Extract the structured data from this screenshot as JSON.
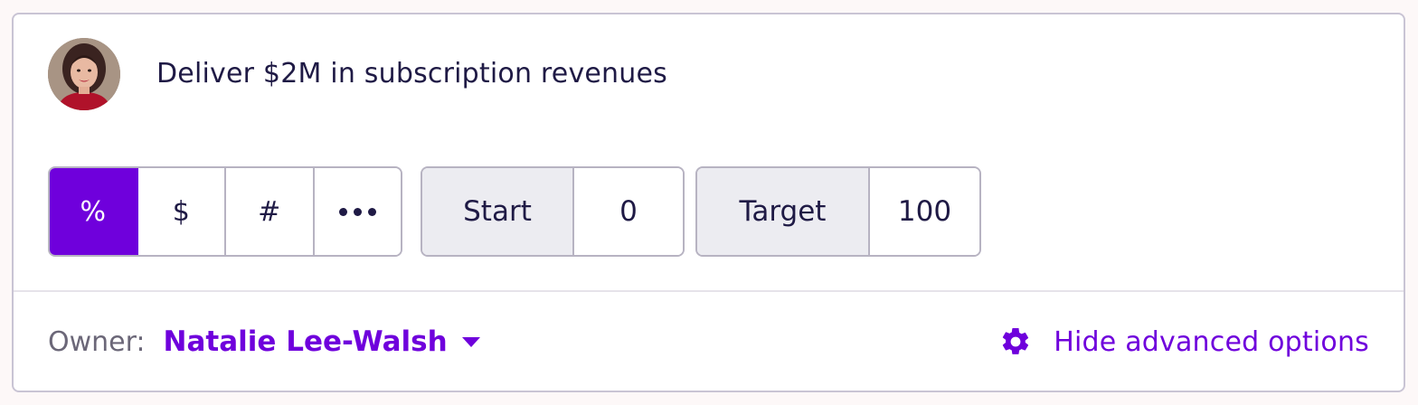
{
  "goal": {
    "title": "Deliver $2M in subscription revenues",
    "avatar_icon": "user-avatar-photo"
  },
  "unit_types": [
    {
      "label": "%",
      "active": true
    },
    {
      "label": "$",
      "active": false
    },
    {
      "label": "#",
      "active": false
    },
    {
      "label": "more",
      "icon": "ellipsis-icon",
      "active": false
    }
  ],
  "start": {
    "label": "Start",
    "value": "0"
  },
  "target": {
    "label": "Target",
    "value": "100"
  },
  "owner": {
    "label": "Owner:",
    "name": "Natalie Lee-Walsh"
  },
  "advanced": {
    "label": "Hide advanced options",
    "icon": "gear-icon"
  },
  "colors": {
    "accent": "#6f00dc",
    "text": "#1f1a45",
    "muted": "#6b6778",
    "border": "#b7b3c2",
    "label_bg": "#ececf1"
  }
}
